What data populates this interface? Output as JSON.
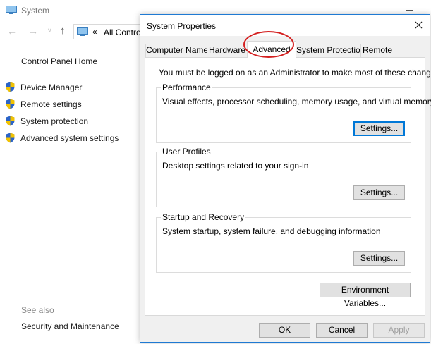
{
  "background_window": {
    "title": "System",
    "address": {
      "chevron": "«",
      "text": "All Contro"
    },
    "left_pane": {
      "home_link": "Control Panel Home",
      "links": [
        {
          "label": "Device Manager",
          "icon": "shield-icon"
        },
        {
          "label": "Remote settings",
          "icon": "shield-icon"
        },
        {
          "label": "System protection",
          "icon": "shield-icon"
        },
        {
          "label": "Advanced system settings",
          "icon": "shield-icon"
        }
      ],
      "see_also": "See also",
      "see_also_links": [
        "Security and Maintenance"
      ]
    }
  },
  "dialog": {
    "title": "System Properties",
    "tabs": [
      {
        "label": "Computer Name",
        "active": false
      },
      {
        "label": "Hardware",
        "active": false
      },
      {
        "label": "Advanced",
        "active": true
      },
      {
        "label": "System Protection",
        "active": false
      },
      {
        "label": "Remote",
        "active": false
      }
    ],
    "admin_note": "You must be logged on as an Administrator to make most of these changes.",
    "groups": {
      "performance": {
        "label": "Performance",
        "description": "Visual effects, processor scheduling, memory usage, and virtual memory",
        "button": "Settings..."
      },
      "user_profiles": {
        "label": "User Profiles",
        "description": "Desktop settings related to your sign-in",
        "button": "Settings..."
      },
      "startup_recovery": {
        "label": "Startup and Recovery",
        "description": "System startup, system failure, and debugging information",
        "button": "Settings..."
      }
    },
    "env_button": "Environment Variables...",
    "ok_button": "OK",
    "cancel_button": "Cancel",
    "apply_button": "Apply"
  },
  "colors": {
    "accent": "#0078d7",
    "annotation": "#d42020",
    "shield_blue": "#2b64c8",
    "shield_yellow": "#f2c200"
  }
}
